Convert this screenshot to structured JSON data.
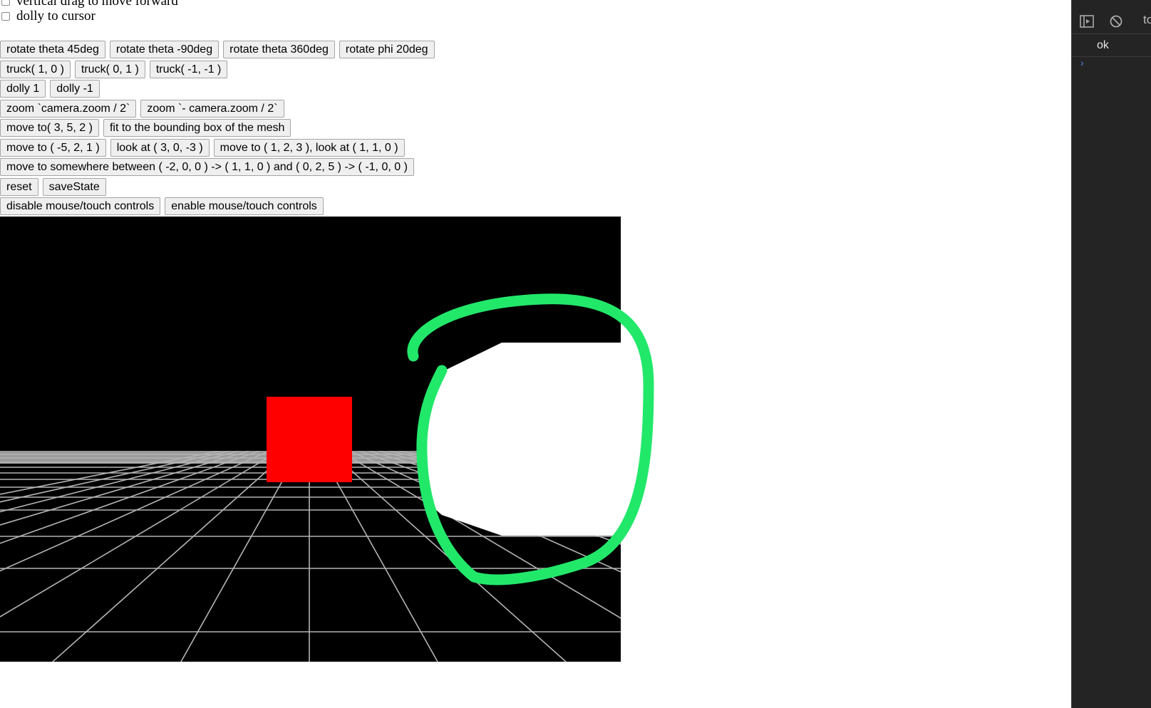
{
  "controls": {
    "checkboxes": [
      {
        "label": "vertical drag to move forward",
        "checked": false
      },
      {
        "label": "dolly to cursor",
        "checked": false
      }
    ],
    "button_rows": [
      [
        "rotate theta 45deg",
        "rotate theta -90deg",
        "rotate theta 360deg",
        "rotate phi 20deg"
      ],
      [
        "truck( 1, 0 )",
        "truck( 0, 1 )",
        "truck( -1, -1 )"
      ],
      [
        "dolly 1",
        "dolly -1"
      ],
      [
        "zoom `camera.zoom / 2`",
        "zoom `- camera.zoom / 2`"
      ],
      [
        "move to( 3, 5, 2 )",
        "fit to the bounding box of the mesh"
      ],
      [
        "move to ( -5, 2, 1 )",
        "look at ( 3, 0, -3 )",
        "move to ( 1, 2, 3 ), look at ( 1, 1, 0 )"
      ],
      [
        "move to somewhere between ( -2, 0, 0 ) -> ( 1, 1, 0 ) and ( 0, 2, 5 ) -> ( -1, 0, 0 )"
      ],
      [
        "reset",
        "saveState"
      ],
      [
        "disable mouse/touch controls",
        "enable mouse/touch controls"
      ]
    ]
  },
  "scene": {
    "background_color": "#000000",
    "ground_color": "#9a9a9a",
    "grid_line_color": "#b4b4b4",
    "cube_color": "#ff0000",
    "white_shape_color": "#ffffff"
  },
  "annotation": {
    "stroke_color": "#22e86a"
  },
  "devtools": {
    "toolbar_icons": [
      "sidebar-toggle-icon",
      "clear-console-icon"
    ],
    "toolbar_label_cut": "to",
    "console_message": "ok",
    "prompt_symbol": "›"
  }
}
